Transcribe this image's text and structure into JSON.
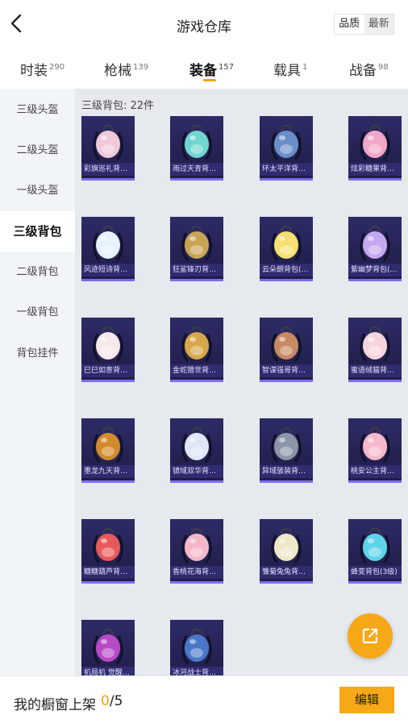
{
  "header": {
    "title": "游戏仓库",
    "sort_quality": "品质",
    "sort_latest": "最新"
  },
  "tabs": [
    {
      "label": "时装",
      "count": "290"
    },
    {
      "label": "枪械",
      "count": "139"
    },
    {
      "label": "装备",
      "count": "157"
    },
    {
      "label": "载具",
      "count": "1"
    },
    {
      "label": "战备",
      "count": "98"
    }
  ],
  "sidebar": {
    "items": [
      "三级头盔",
      "二级头盔",
      "一级头盔",
      "三级背包",
      "二级背包",
      "一级背包",
      "背包挂件"
    ]
  },
  "content": {
    "count_label": "三级背包: 22件",
    "items": [
      {
        "name": "彩旗巡礼背包...",
        "color": "#f0c8d8"
      },
      {
        "name": "雨过天青背包...",
        "color": "#6fd6d0"
      },
      {
        "name": "环太平洋背包...",
        "color": "#6a8fc8"
      },
      {
        "name": "炫彩糖果背包...",
        "color": "#f2a6c8"
      },
      {
        "name": "风迹短诗背包...",
        "color": "#e6f2ff"
      },
      {
        "name": "狂鲨锋刃背包...",
        "color": "#c9a455"
      },
      {
        "name": "云朵朗背包(3...",
        "color": "#f5e070"
      },
      {
        "name": "紫幽梦背包(3...",
        "color": "#c4a8f0"
      },
      {
        "name": "巳巳如意背包...",
        "color": "#f8e8ea"
      },
      {
        "name": "金蛇猎世背包...",
        "color": "#d7a84a"
      },
      {
        "name": "智谋强哥背包...",
        "color": "#c98a62"
      },
      {
        "name": "蜜语绒猫背包...",
        "color": "#f6d4dc"
      },
      {
        "name": "墨龙九天背包...",
        "color": "#d28a2c"
      },
      {
        "name": "镜域双华背包...",
        "color": "#dfe6f8"
      },
      {
        "name": "异域骇装背包...",
        "color": "#8a96a8"
      },
      {
        "name": "桃安公主背包...",
        "color": "#f7b8cc"
      },
      {
        "name": "糖糖葫芦背包...",
        "color": "#e85a5a"
      },
      {
        "name": "香桃花海背包...",
        "color": "#f4b6c8"
      },
      {
        "name": "雏菊兔兔背包...",
        "color": "#efe8c8"
      },
      {
        "name": "蜂变背包(3级)",
        "color": "#5fd4e8"
      },
      {
        "name": "机局机 觉醒V...",
        "color": "#b84ac8"
      },
      {
        "name": "冰河战士背包...",
        "color": "#4a78c8"
      }
    ]
  },
  "footer": {
    "label": "我的橱窗上架",
    "current": "0",
    "separator": "/",
    "max": "5",
    "edit_label": "编辑"
  },
  "colors": {
    "accent": "#f5a300",
    "card_bg": "#2a2860",
    "card_border": "#7b6cf0"
  },
  "icons": {
    "back": "chevron-left-icon",
    "fab": "share-external-icon"
  }
}
